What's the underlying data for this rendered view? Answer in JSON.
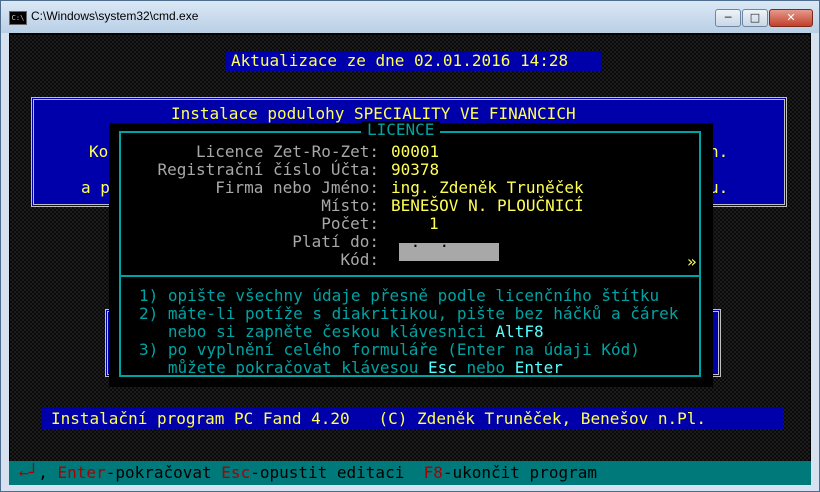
{
  "window": {
    "title": "C:\\Windows\\system32\\cmd.exe",
    "icon_text": "C:\\",
    "min_symbol": "─",
    "max_symbol": "□",
    "close_symbol": "✕"
  },
  "header_banner": "Aktualizace ze dne 02.01.2016 14:28",
  "install_box": {
    "title": "Instalace podulohy SPECIALITY VE FINANCICH",
    "line2_left": "Ko",
    "line2_right": "h.",
    "line3_left": "a p",
    "line3_right": "u."
  },
  "dialog": {
    "title": "LICENCE",
    "fields": [
      {
        "label": "Licence Zet-Ro-Zet:",
        "value": "00001"
      },
      {
        "label": "Registrační číslo Účta:",
        "value": "90378"
      },
      {
        "label": "Firma nebo Jméno:",
        "value": "ing. Zdeněk Truněček"
      },
      {
        "label": "Místo:",
        "value": "BENEŠOV N. PLOUČNICÍ"
      },
      {
        "label": "Počet:",
        "value": "1"
      },
      {
        "label": "Platí do:",
        "value": " .  ."
      },
      {
        "label": "Kód:",
        "value": ""
      }
    ],
    "more_marker": "»",
    "instructions": {
      "l1": "1) opište všechny údaje přesně podle licenčního štítku",
      "l2": "2) máte-li potíže s diakritikou, pište bez háčků a čárek",
      "l3_pre": "   nebo si zapněte českou klávesnici ",
      "l3_key": "AltF8",
      "l4": "3) po vyplnění celého formuláře (Enter na údaji Kód)",
      "l5_pre": "   můžete pokračovat klávesou ",
      "l5_key1": "Esc",
      "l5_mid": " nebo ",
      "l5_key2": "Enter"
    }
  },
  "status_bar": "Instalační program PC Fand 4.20   (C) Zdeněk Truněček, Benešov n.Pl.",
  "key_bar": {
    "enter_symbol": "←┘",
    "sep1": ", ",
    "enter_key": "Enter",
    "enter_text": "-pokračovat ",
    "esc_key": "Esc",
    "esc_text": "-opustit editaci  ",
    "f8_key": "F8",
    "f8_text": "-ukončit program"
  },
  "colors": {
    "dos_blue": "#0000aa",
    "dos_yellow": "#ffff55",
    "dos_cyan": "#00a3a3",
    "dos_red": "#aa0000"
  }
}
